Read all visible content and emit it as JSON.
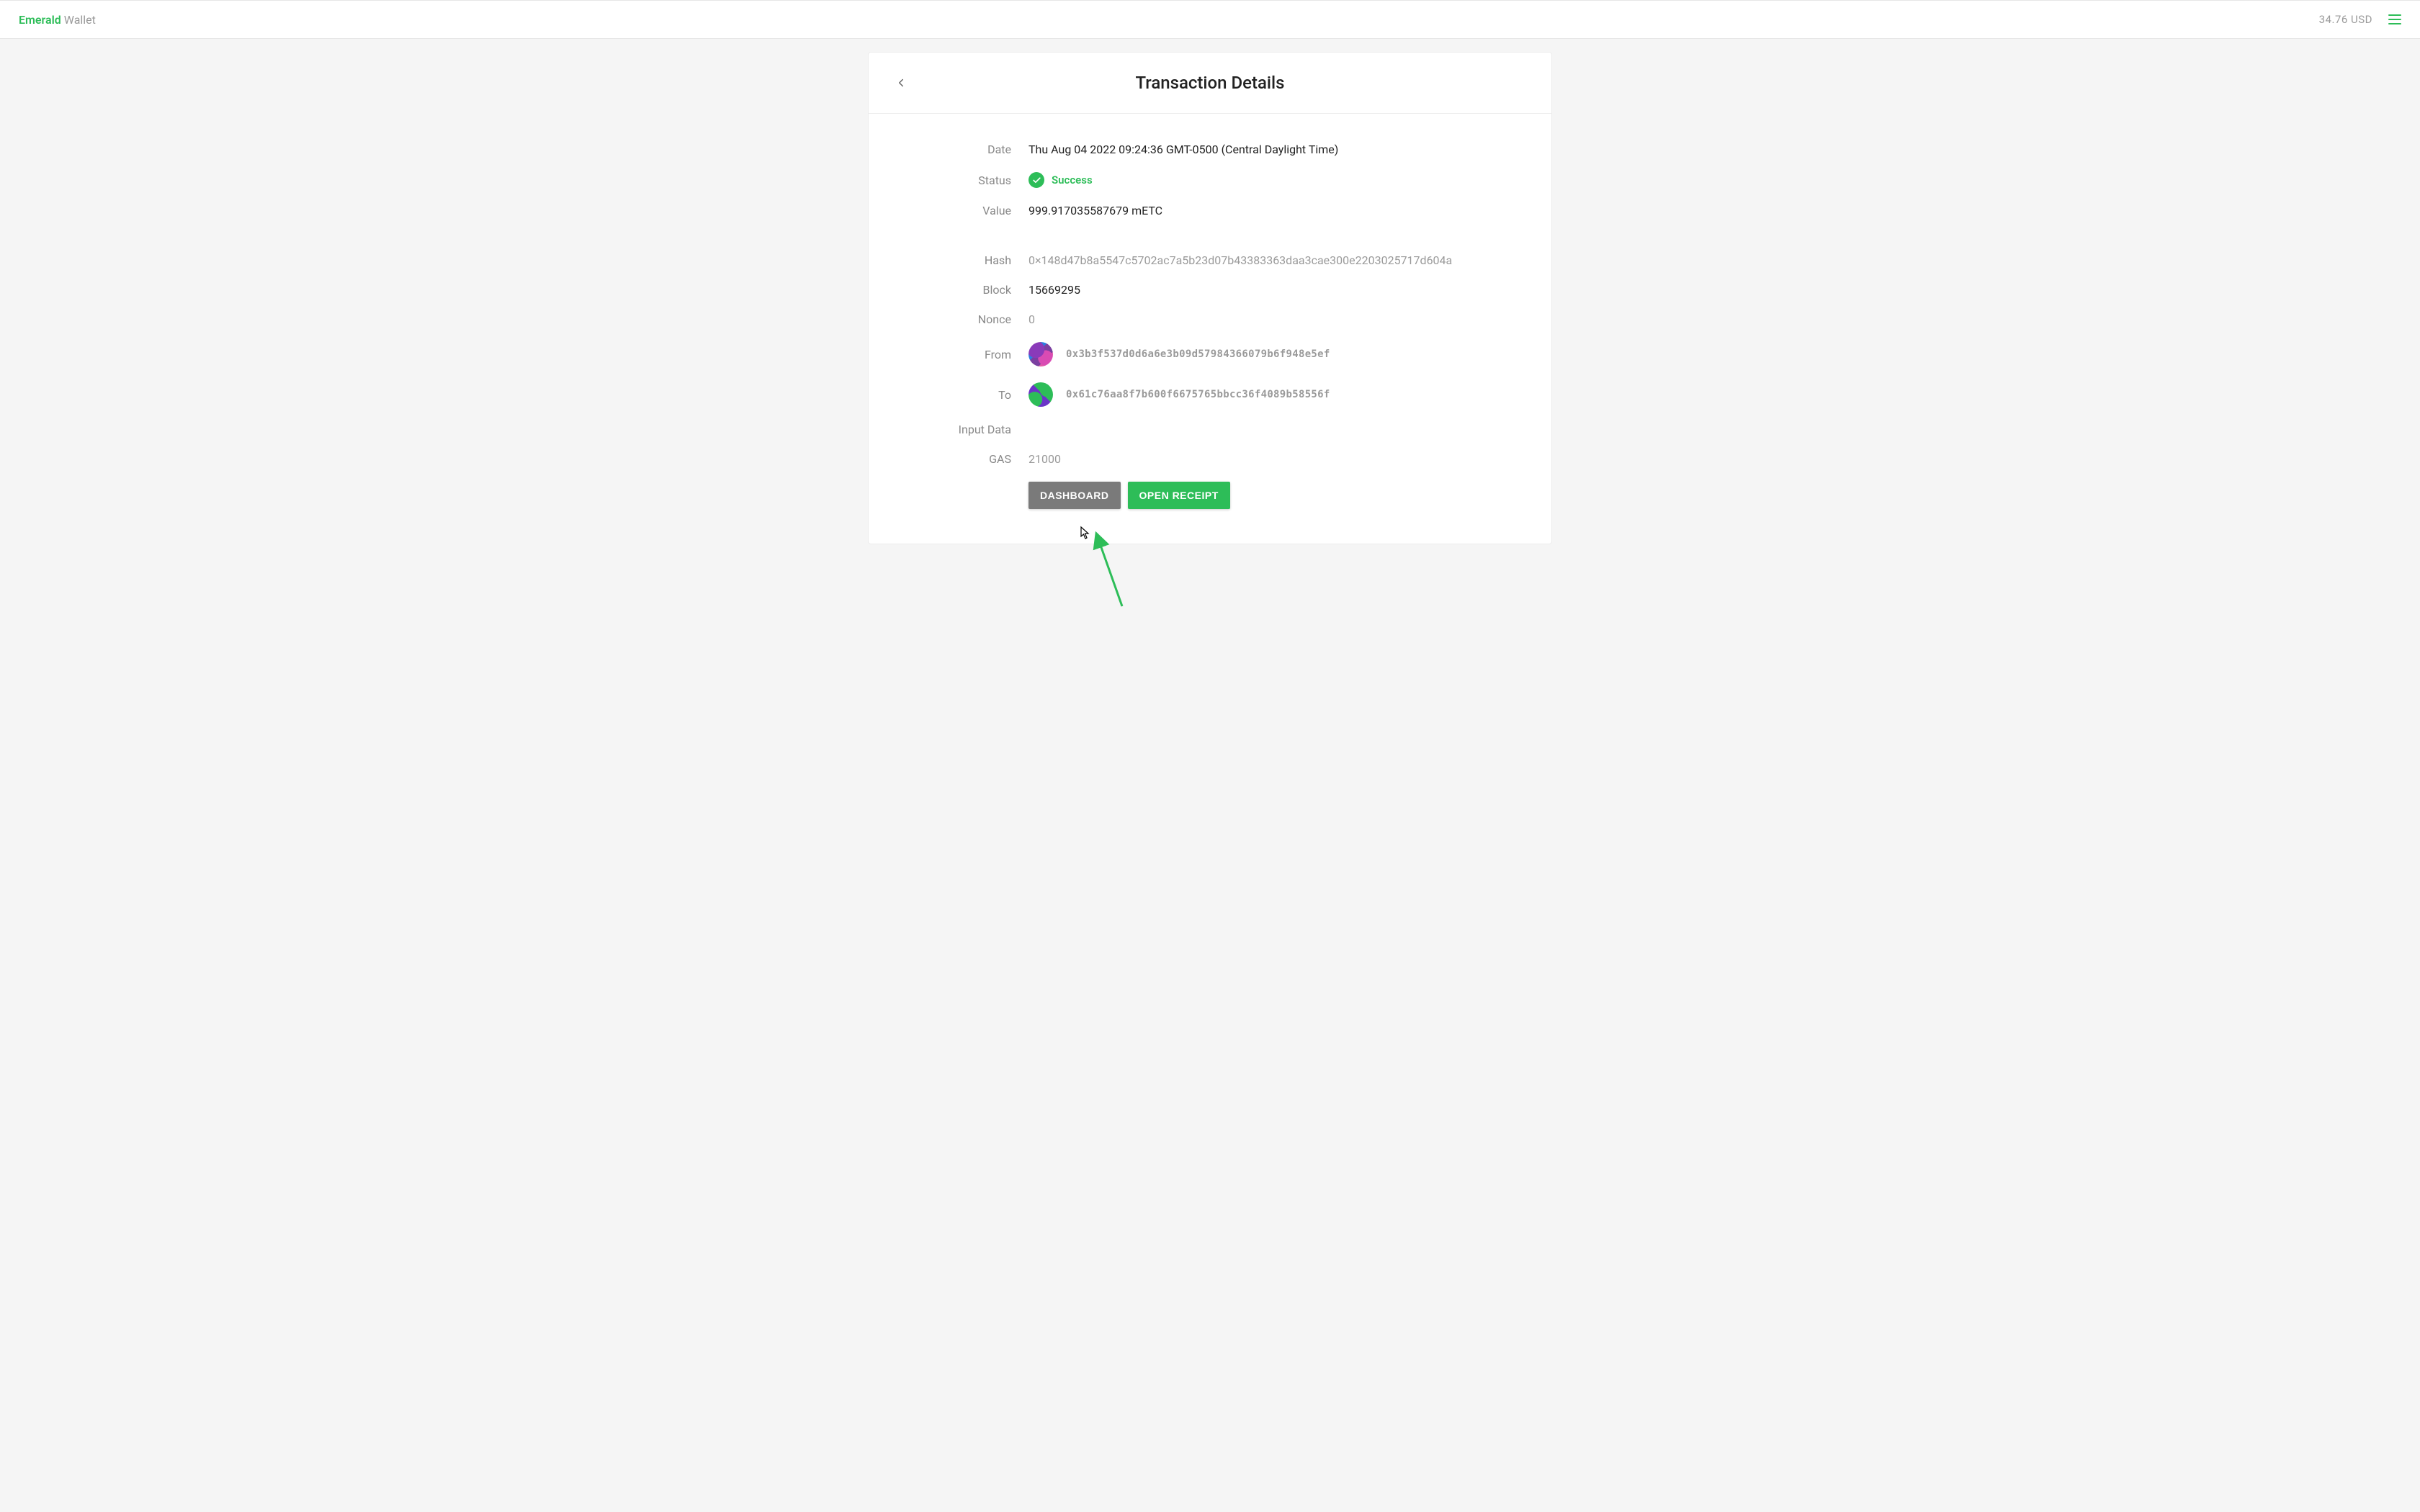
{
  "header": {
    "brand_emerald": "Emerald",
    "brand_wallet": " Wallet",
    "balance": "34.76 USD"
  },
  "card": {
    "title": "Transaction Details"
  },
  "tx": {
    "labels": {
      "date": "Date",
      "status": "Status",
      "value": "Value",
      "hash": "Hash",
      "block": "Block",
      "nonce": "Nonce",
      "from": "From",
      "to": "To",
      "input_data": "Input Data",
      "gas": "GAS"
    },
    "date": "Thu Aug 04 2022 09:24:36 GMT-0500 (Central Daylight Time)",
    "status": "Success",
    "value": "999.917035587679 mETC",
    "hash": "0×148d47b8a5547c5702ac7a5b23d07b43383363daa3cae300e2203025717d604a",
    "block": "15669295",
    "nonce": "0",
    "from": "0x3b3f537d0d6a6e3b09d57984366079b6f948e5ef",
    "to": "0x61c76aa8f7b600f6675765bbcc36f4089b58556f",
    "input_data": "",
    "gas": "21000"
  },
  "actions": {
    "dashboard": "DASHBOARD",
    "open_receipt": "OPEN RECEIPT"
  }
}
